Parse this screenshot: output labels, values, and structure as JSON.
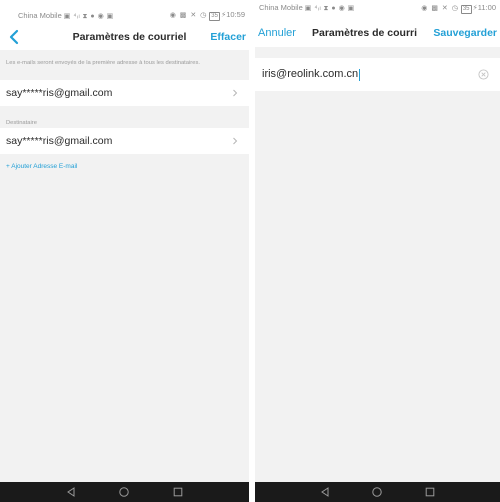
{
  "left_screen": {
    "status": {
      "carrier": "China Mobile",
      "time": "10:59",
      "battery": "35"
    },
    "nav": {
      "title": "Paramètres de courriel",
      "clear_label": "Effacer"
    },
    "sender_note": "Les e-mails seront envoyés de la première adresse à tous les destinataires.",
    "sender_email": "say*****ris@gmail.com",
    "recipient_section_label": "Destinataire",
    "recipient_email": "say*****ris@gmail.com",
    "add_email_label": "+ Ajouter Adresse E-mail"
  },
  "right_screen": {
    "status": {
      "carrier": "China Mobile",
      "time": "11:00",
      "battery": "35"
    },
    "nav": {
      "cancel_label": "Annuler",
      "title": "Paramètres de courri",
      "save_label": "Sauvegarder"
    },
    "email_input_value": "iris@reolink.com.cn"
  },
  "colors": {
    "accent": "#23a0d6",
    "background": "#f2f2f2",
    "text": "#2b2b2b",
    "nav_bar": "#1a1a1a"
  },
  "icons": [
    "back-arrow-icon",
    "chevron-right-icon",
    "clear-circle-icon",
    "android-back-icon",
    "android-home-icon",
    "android-recents-icon"
  ]
}
